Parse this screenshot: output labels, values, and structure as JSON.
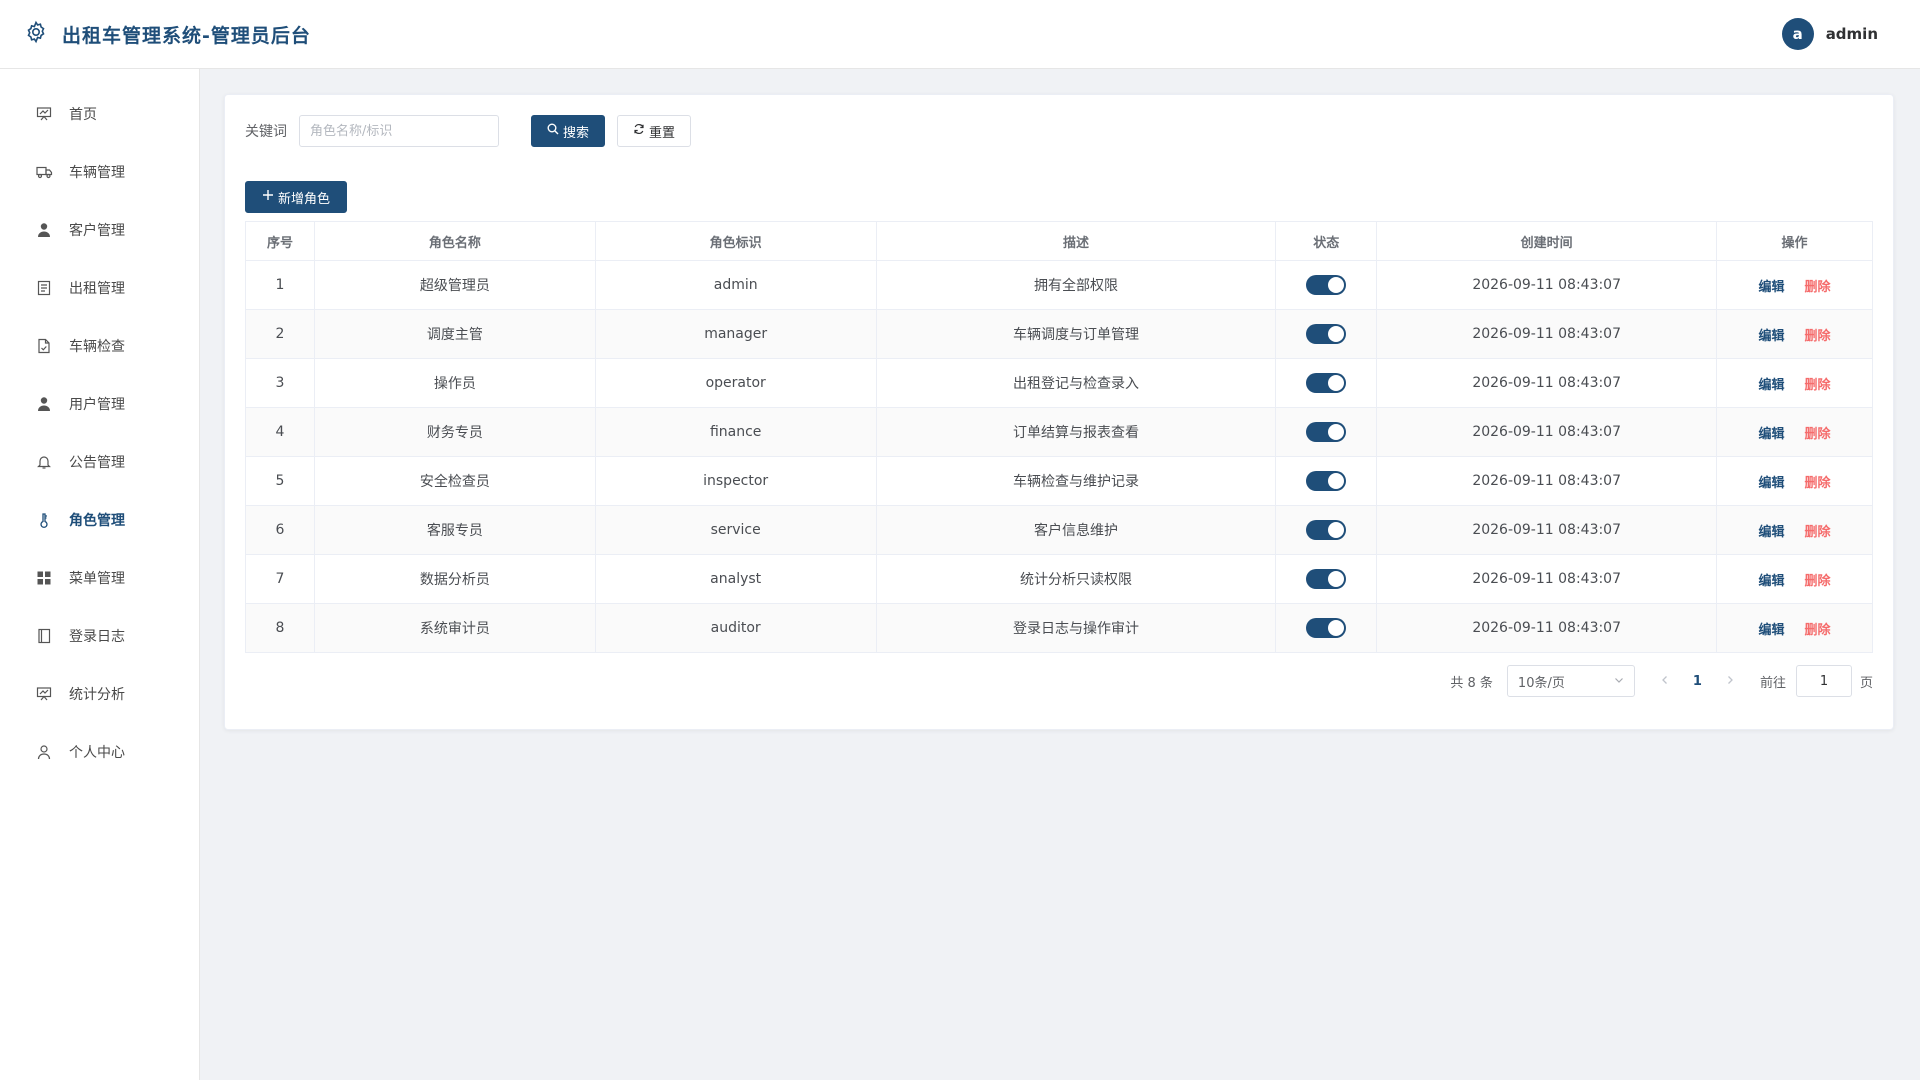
{
  "header": {
    "title": "出租车管理系统-管理员后台",
    "avatar_letter": "a",
    "username": "admin"
  },
  "sidebar": {
    "items": [
      {
        "label": "首页",
        "icon": "presentation-board-icon"
      },
      {
        "label": "车辆管理",
        "icon": "truck-icon"
      },
      {
        "label": "客户管理",
        "icon": "person-icon"
      },
      {
        "label": "出租管理",
        "icon": "document-icon"
      },
      {
        "label": "车辆检查",
        "icon": "file-check-icon"
      },
      {
        "label": "用户管理",
        "icon": "person-icon"
      },
      {
        "label": "公告管理",
        "icon": "bell-icon"
      },
      {
        "label": "角色管理",
        "icon": "thermometer-icon",
        "active": true
      },
      {
        "label": "菜单管理",
        "icon": "grid-icon"
      },
      {
        "label": "登录日志",
        "icon": "notebook-icon"
      },
      {
        "label": "统计分析",
        "icon": "presentation-board-icon"
      },
      {
        "label": "个人中心",
        "icon": "user-outline-icon"
      }
    ]
  },
  "search": {
    "label": "关键词",
    "placeholder": "角色名称/标识",
    "value": "",
    "search_button": "搜索",
    "reset_button": "重置"
  },
  "add_button": "新增角色",
  "table": {
    "columns": [
      "序号",
      "角色名称",
      "角色标识",
      "描述",
      "状态",
      "创建时间",
      "操作"
    ],
    "rows": [
      {
        "index": "1",
        "name": "超级管理员",
        "key": "admin",
        "desc": "拥有全部权限",
        "enabled": true,
        "created": "2026-09-11 08:43:07"
      },
      {
        "index": "2",
        "name": "调度主管",
        "key": "manager",
        "desc": "车辆调度与订单管理",
        "enabled": true,
        "created": "2026-09-11 08:43:07"
      },
      {
        "index": "3",
        "name": "操作员",
        "key": "operator",
        "desc": "出租登记与检查录入",
        "enabled": true,
        "created": "2026-09-11 08:43:07"
      },
      {
        "index": "4",
        "name": "财务专员",
        "key": "finance",
        "desc": "订单结算与报表查看",
        "enabled": true,
        "created": "2026-09-11 08:43:07"
      },
      {
        "index": "5",
        "name": "安全检查员",
        "key": "inspector",
        "desc": "车辆检查与维护记录",
        "enabled": true,
        "created": "2026-09-11 08:43:07"
      },
      {
        "index": "6",
        "name": "客服专员",
        "key": "service",
        "desc": "客户信息维护",
        "enabled": true,
        "created": "2026-09-11 08:43:07"
      },
      {
        "index": "7",
        "name": "数据分析员",
        "key": "analyst",
        "desc": "统计分析只读权限",
        "enabled": true,
        "created": "2026-09-11 08:43:07"
      },
      {
        "index": "8",
        "name": "系统审计员",
        "key": "auditor",
        "desc": "登录日志与操作审计",
        "enabled": true,
        "created": "2026-09-11 08:43:07"
      }
    ],
    "edit_label": "编辑",
    "delete_label": "删除"
  },
  "pagination": {
    "total": "共 8 条",
    "page_size": "10条/页",
    "current_page": "1",
    "goto_label": "前往",
    "goto_value": "1",
    "page_suffix": "页"
  },
  "colors": {
    "primary": "#1f4e79",
    "danger": "#f56c6c",
    "background": "#f0f2f5"
  }
}
